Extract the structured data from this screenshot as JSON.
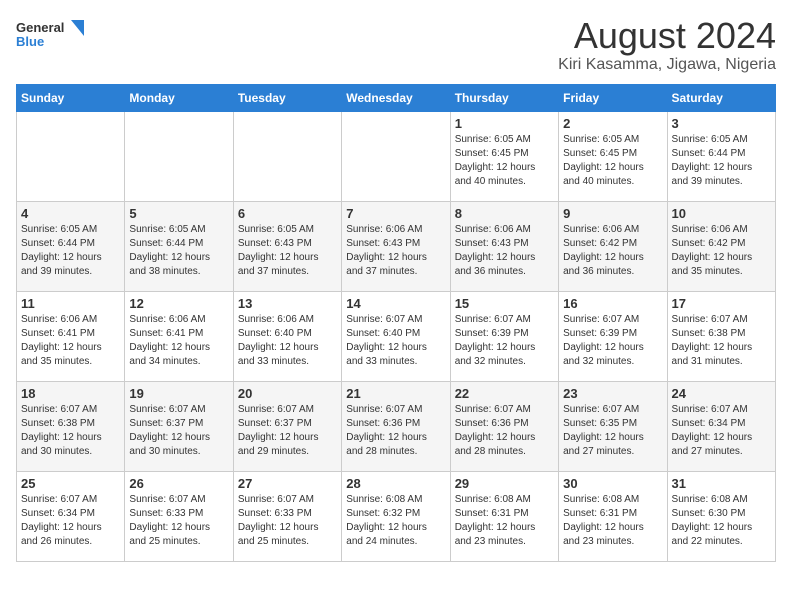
{
  "header": {
    "logo_line1": "General",
    "logo_line2": "Blue",
    "title": "August 2024",
    "subtitle": "Kiri Kasamma, Jigawa, Nigeria"
  },
  "weekdays": [
    "Sunday",
    "Monday",
    "Tuesday",
    "Wednesday",
    "Thursday",
    "Friday",
    "Saturday"
  ],
  "weeks": [
    [
      {
        "num": "",
        "content": ""
      },
      {
        "num": "",
        "content": ""
      },
      {
        "num": "",
        "content": ""
      },
      {
        "num": "",
        "content": ""
      },
      {
        "num": "1",
        "content": "Sunrise: 6:05 AM\nSunset: 6:45 PM\nDaylight: 12 hours\nand 40 minutes."
      },
      {
        "num": "2",
        "content": "Sunrise: 6:05 AM\nSunset: 6:45 PM\nDaylight: 12 hours\nand 40 minutes."
      },
      {
        "num": "3",
        "content": "Sunrise: 6:05 AM\nSunset: 6:44 PM\nDaylight: 12 hours\nand 39 minutes."
      }
    ],
    [
      {
        "num": "4",
        "content": "Sunrise: 6:05 AM\nSunset: 6:44 PM\nDaylight: 12 hours\nand 39 minutes."
      },
      {
        "num": "5",
        "content": "Sunrise: 6:05 AM\nSunset: 6:44 PM\nDaylight: 12 hours\nand 38 minutes."
      },
      {
        "num": "6",
        "content": "Sunrise: 6:05 AM\nSunset: 6:43 PM\nDaylight: 12 hours\nand 37 minutes."
      },
      {
        "num": "7",
        "content": "Sunrise: 6:06 AM\nSunset: 6:43 PM\nDaylight: 12 hours\nand 37 minutes."
      },
      {
        "num": "8",
        "content": "Sunrise: 6:06 AM\nSunset: 6:43 PM\nDaylight: 12 hours\nand 36 minutes."
      },
      {
        "num": "9",
        "content": "Sunrise: 6:06 AM\nSunset: 6:42 PM\nDaylight: 12 hours\nand 36 minutes."
      },
      {
        "num": "10",
        "content": "Sunrise: 6:06 AM\nSunset: 6:42 PM\nDaylight: 12 hours\nand 35 minutes."
      }
    ],
    [
      {
        "num": "11",
        "content": "Sunrise: 6:06 AM\nSunset: 6:41 PM\nDaylight: 12 hours\nand 35 minutes."
      },
      {
        "num": "12",
        "content": "Sunrise: 6:06 AM\nSunset: 6:41 PM\nDaylight: 12 hours\nand 34 minutes."
      },
      {
        "num": "13",
        "content": "Sunrise: 6:06 AM\nSunset: 6:40 PM\nDaylight: 12 hours\nand 33 minutes."
      },
      {
        "num": "14",
        "content": "Sunrise: 6:07 AM\nSunset: 6:40 PM\nDaylight: 12 hours\nand 33 minutes."
      },
      {
        "num": "15",
        "content": "Sunrise: 6:07 AM\nSunset: 6:39 PM\nDaylight: 12 hours\nand 32 minutes."
      },
      {
        "num": "16",
        "content": "Sunrise: 6:07 AM\nSunset: 6:39 PM\nDaylight: 12 hours\nand 32 minutes."
      },
      {
        "num": "17",
        "content": "Sunrise: 6:07 AM\nSunset: 6:38 PM\nDaylight: 12 hours\nand 31 minutes."
      }
    ],
    [
      {
        "num": "18",
        "content": "Sunrise: 6:07 AM\nSunset: 6:38 PM\nDaylight: 12 hours\nand 30 minutes."
      },
      {
        "num": "19",
        "content": "Sunrise: 6:07 AM\nSunset: 6:37 PM\nDaylight: 12 hours\nand 30 minutes."
      },
      {
        "num": "20",
        "content": "Sunrise: 6:07 AM\nSunset: 6:37 PM\nDaylight: 12 hours\nand 29 minutes."
      },
      {
        "num": "21",
        "content": "Sunrise: 6:07 AM\nSunset: 6:36 PM\nDaylight: 12 hours\nand 28 minutes."
      },
      {
        "num": "22",
        "content": "Sunrise: 6:07 AM\nSunset: 6:36 PM\nDaylight: 12 hours\nand 28 minutes."
      },
      {
        "num": "23",
        "content": "Sunrise: 6:07 AM\nSunset: 6:35 PM\nDaylight: 12 hours\nand 27 minutes."
      },
      {
        "num": "24",
        "content": "Sunrise: 6:07 AM\nSunset: 6:34 PM\nDaylight: 12 hours\nand 27 minutes."
      }
    ],
    [
      {
        "num": "25",
        "content": "Sunrise: 6:07 AM\nSunset: 6:34 PM\nDaylight: 12 hours\nand 26 minutes."
      },
      {
        "num": "26",
        "content": "Sunrise: 6:07 AM\nSunset: 6:33 PM\nDaylight: 12 hours\nand 25 minutes."
      },
      {
        "num": "27",
        "content": "Sunrise: 6:07 AM\nSunset: 6:33 PM\nDaylight: 12 hours\nand 25 minutes."
      },
      {
        "num": "28",
        "content": "Sunrise: 6:08 AM\nSunset: 6:32 PM\nDaylight: 12 hours\nand 24 minutes."
      },
      {
        "num": "29",
        "content": "Sunrise: 6:08 AM\nSunset: 6:31 PM\nDaylight: 12 hours\nand 23 minutes."
      },
      {
        "num": "30",
        "content": "Sunrise: 6:08 AM\nSunset: 6:31 PM\nDaylight: 12 hours\nand 23 minutes."
      },
      {
        "num": "31",
        "content": "Sunrise: 6:08 AM\nSunset: 6:30 PM\nDaylight: 12 hours\nand 22 minutes."
      }
    ]
  ]
}
